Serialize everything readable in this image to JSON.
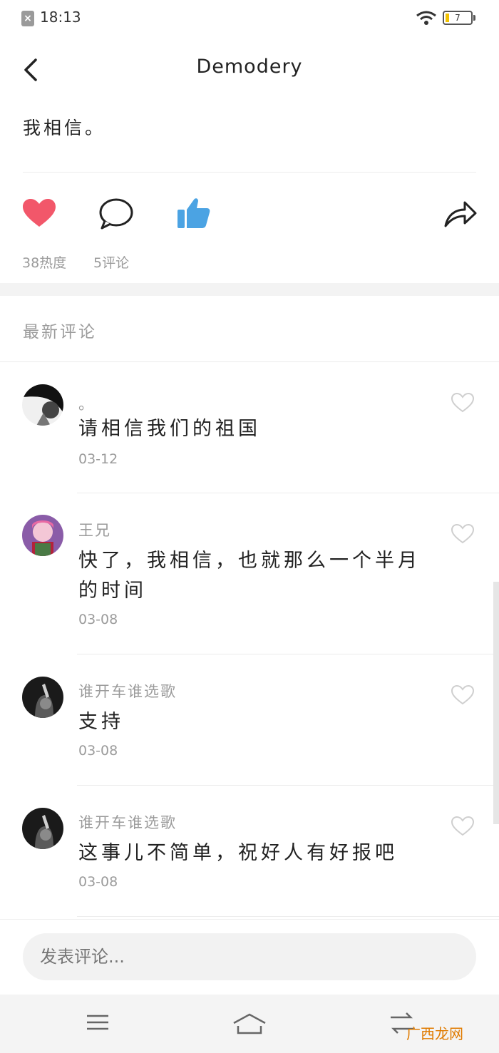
{
  "status_bar": {
    "time": "18:13",
    "battery": "7"
  },
  "header": {
    "title": "Demodery"
  },
  "post": {
    "text": "我相信。"
  },
  "stats": {
    "heat": "38热度",
    "comments": "5评论"
  },
  "comments_section": {
    "title": "最新评论",
    "items": [
      {
        "user": "。",
        "text": "请相信我们的祖国",
        "date": "03-12"
      },
      {
        "user": "王兄",
        "text": "快了，我相信，也就那么一个半月的时间",
        "date": "03-08"
      },
      {
        "user": "谁开车谁选歌",
        "text": "支持",
        "date": "03-08"
      },
      {
        "user": "谁开车谁选歌",
        "text": "这事儿不简单，祝好人有好报吧",
        "date": "03-08"
      }
    ]
  },
  "input": {
    "placeholder": "发表评论..."
  },
  "watermark": "广西龙网",
  "colors": {
    "like": "#f2576a",
    "thumb": "#4ba3e3",
    "muted": "#9b9b9b"
  }
}
